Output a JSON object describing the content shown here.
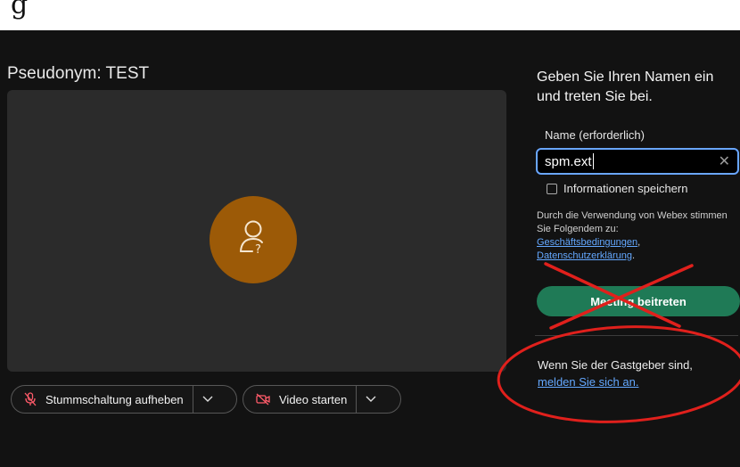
{
  "header_strip": {
    "cut_text": "g"
  },
  "preview": {
    "pseudonym": "Pseudonym: TEST",
    "avatar_color": "#9c5a07"
  },
  "controls": {
    "mute_label": "Stummschaltung aufheben",
    "video_label": "Video starten"
  },
  "join_panel": {
    "title": "Geben Sie Ihren Namen ein und treten Sie bei.",
    "name_label": "Name (erforderlich)",
    "name_value": "spm.ext",
    "save_label": "Informationen speichern",
    "terms_text": "Durch die Verwendung von Webex stimmen Sie Folgendem zu:",
    "terms_link_1": "Geschäftsbedingungen",
    "terms_link_2": "Datenschutzerklärung",
    "join_button": "Meeting beitreten",
    "host_text": "Wenn Sie der Gastgeber sind,",
    "host_link": "melden Sie sich an."
  },
  "colors": {
    "background": "#121212",
    "accent_green": "#1f7a56",
    "link_blue": "#64a8ff",
    "annotation_red": "#e0201c"
  }
}
